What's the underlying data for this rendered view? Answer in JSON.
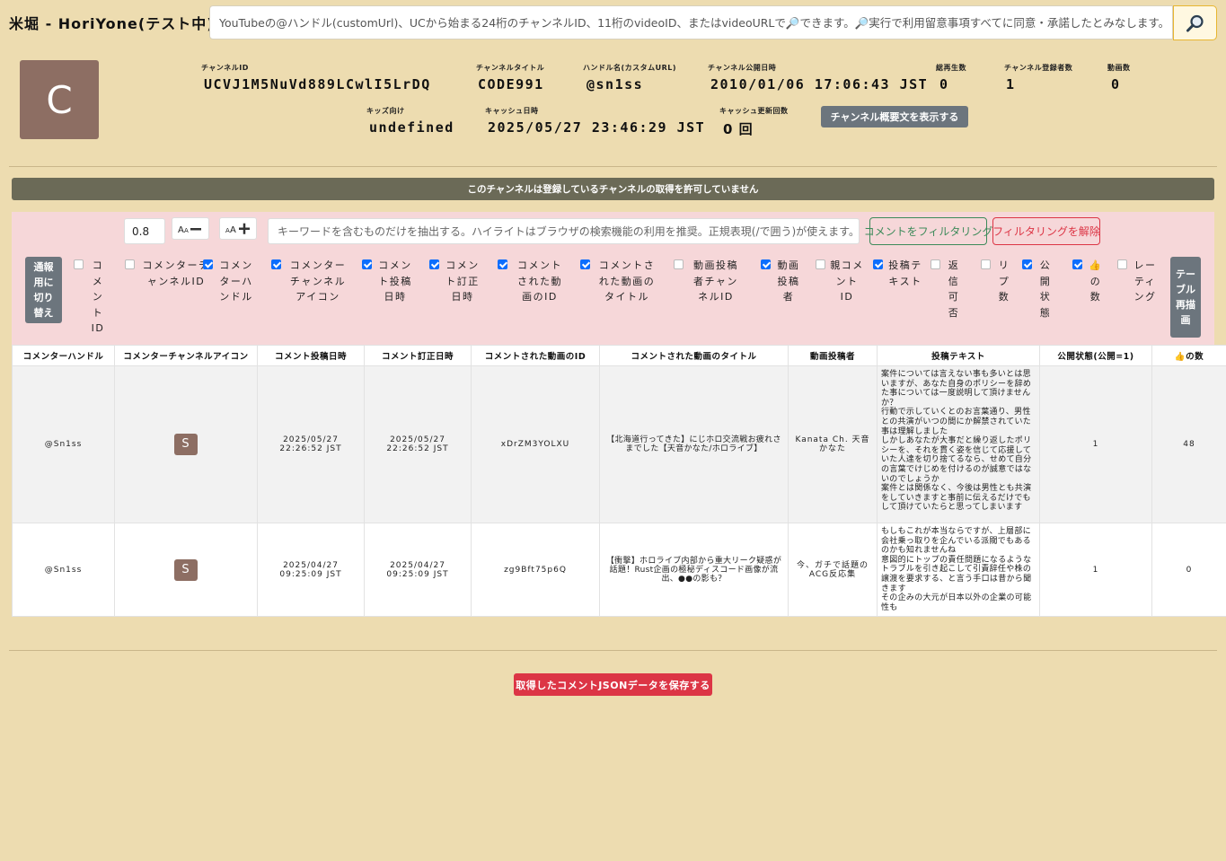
{
  "app": {
    "title": "米堀 - HoriYone(テスト中)"
  },
  "search": {
    "placeholder": "YouTubeの@ハンドル(customUrl)、UCから始まる24桁のチャンネルID、11桁のvideoID、またはvideoURLで🔎できます。🔎実行で利用留意事項すべてに同意・承諾したとみなします。",
    "button_icon": "search-icon"
  },
  "channel": {
    "avatar_letter": "C",
    "avatar_color": "#8d6e63",
    "id_label": "チャンネルID",
    "id": "UCVJ1M5NuVd889LCwlI5LrDQ",
    "title_label": "チャンネルタイトル",
    "title": "CODE991",
    "handle_label": "ハンドル名(カスタムURL)",
    "handle": "@sn1ss",
    "published_label": "チャンネル公開日時",
    "published": "2010/01/06 17:06:43 JST",
    "views_label": "総再生数",
    "views": "0",
    "subs_label": "チャンネル登録者数",
    "subs": "1",
    "videos_label": "動画数",
    "videos": "0",
    "kids_label": "キッズ向け",
    "kids": "undefined",
    "cache_label": "キャッシュ日時",
    "cache": "2025/05/27 23:46:29 JST",
    "cache_count_label": "キャッシュ更新回数",
    "cache_count": "0 回",
    "desc_button": "チャンネル概要文を表示する"
  },
  "notice": "このチャンネルは登録しているチャンネルの取得を許可していません",
  "filter": {
    "zoom_value": "0.8",
    "font_minus": "A↓",
    "font_plus": "A↑",
    "keyword_placeholder": "キーワードを含むものだけを抽出する。ハイライトはブラウザの検索機能の利用を推奨。正規表現(/で囲う)が使えます。(e.g. /(BC|A",
    "filter_button": "コメントをフィルタリング",
    "unfilter_button": "フィルタリングを解除",
    "toggle_button": "通報用に切り替え",
    "redraw_button": "テーブル再描画",
    "columns": [
      {
        "label": "コメントID",
        "checked": false
      },
      {
        "label": "コメンターチャンネルID",
        "checked": false
      },
      {
        "label": "コメンターハンドル",
        "checked": true
      },
      {
        "label": "コメンターチャンネルアイコン",
        "checked": true
      },
      {
        "label": "コメント投稿日時",
        "checked": true
      },
      {
        "label": "コメント訂正日時",
        "checked": true
      },
      {
        "label": "コメントされた動画のID",
        "checked": true
      },
      {
        "label": "コメントされた動画のタイトル",
        "checked": true
      },
      {
        "label": "動画投稿者チャンネルID",
        "checked": false
      },
      {
        "label": "動画投稿者",
        "checked": true
      },
      {
        "label": "親コメントID",
        "checked": false
      },
      {
        "label": "投稿テキスト",
        "checked": true
      },
      {
        "label": "返信可否",
        "checked": false
      },
      {
        "label": "リプ数",
        "checked": false
      },
      {
        "label": "公開状態",
        "checked": true
      },
      {
        "label": "👍の数",
        "checked": true
      },
      {
        "label": "レーティング",
        "checked": false
      }
    ]
  },
  "table": {
    "headers": [
      "コメンターハンドル",
      "コメンターチャンネルアイコン",
      "コメント投稿日時",
      "コメント訂正日時",
      "コメントされた動画のID",
      "コメントされた動画のタイトル",
      "動画投稿者",
      "投稿テキスト",
      "公開状態(公開=1)",
      "👍の数"
    ],
    "rows": [
      {
        "handle": "@Sn1ss",
        "icon_letter": "S",
        "posted": "2025/05/27 22:26:52 JST",
        "edited": "2025/05/27 22:26:52 JST",
        "video_id": "xDrZM3YOLXU",
        "video_title": "【北海道行ってきた】にじホロ交流戦お疲れさまでした【天音かなた/ホロライブ】",
        "uploader": "Kanata Ch. 天音かなた",
        "text": "案件については言えない事も多いとは思いますが、あなた自身のポリシーを辞めた事については一度説明して頂けませんか？\n行動で示していくとのお言葉通り、男性との共演がいつの間にか解禁されていた事は理解しました\nしかしあなたが大事だと繰り返したポリシーを、それを貫く姿を信じて応援していた人達を切り捨てるなら、せめて自分の言葉でけじめを付けるのが誠意ではないのでしょうか\n案件とは関係なく、今後は男性とも共演をしていきますと事前に伝えるだけでもして頂けていたらと思ってしまいます",
        "status": "1",
        "likes": "48"
      },
      {
        "handle": "@Sn1ss",
        "icon_letter": "S",
        "posted": "2025/04/27 09:25:09 JST",
        "edited": "2025/04/27 09:25:09 JST",
        "video_id": "zg9Bft75p6Q",
        "video_title": "【衝撃】ホロライブ内部から重大リーク疑惑が話題！Rust企画の極秘ディスコード画像が流出、●●の影も？",
        "uploader": "今、ガチで話題のACG反応集",
        "text": "もしもこれが本当ならですが、上層部に会社乗っ取りを企んでいる派閥でもあるのかも知れませんね\n意図的にトップの責任問題になるようなトラブルを引き起こして引責辞任や株の譲渡を要求する、と言う手口は昔から聞きます\nその企みの大元が日本以外の企業の可能性も",
        "status": "1",
        "likes": "0"
      }
    ]
  },
  "save_button": "取得したコメントJSONデータを保存する"
}
